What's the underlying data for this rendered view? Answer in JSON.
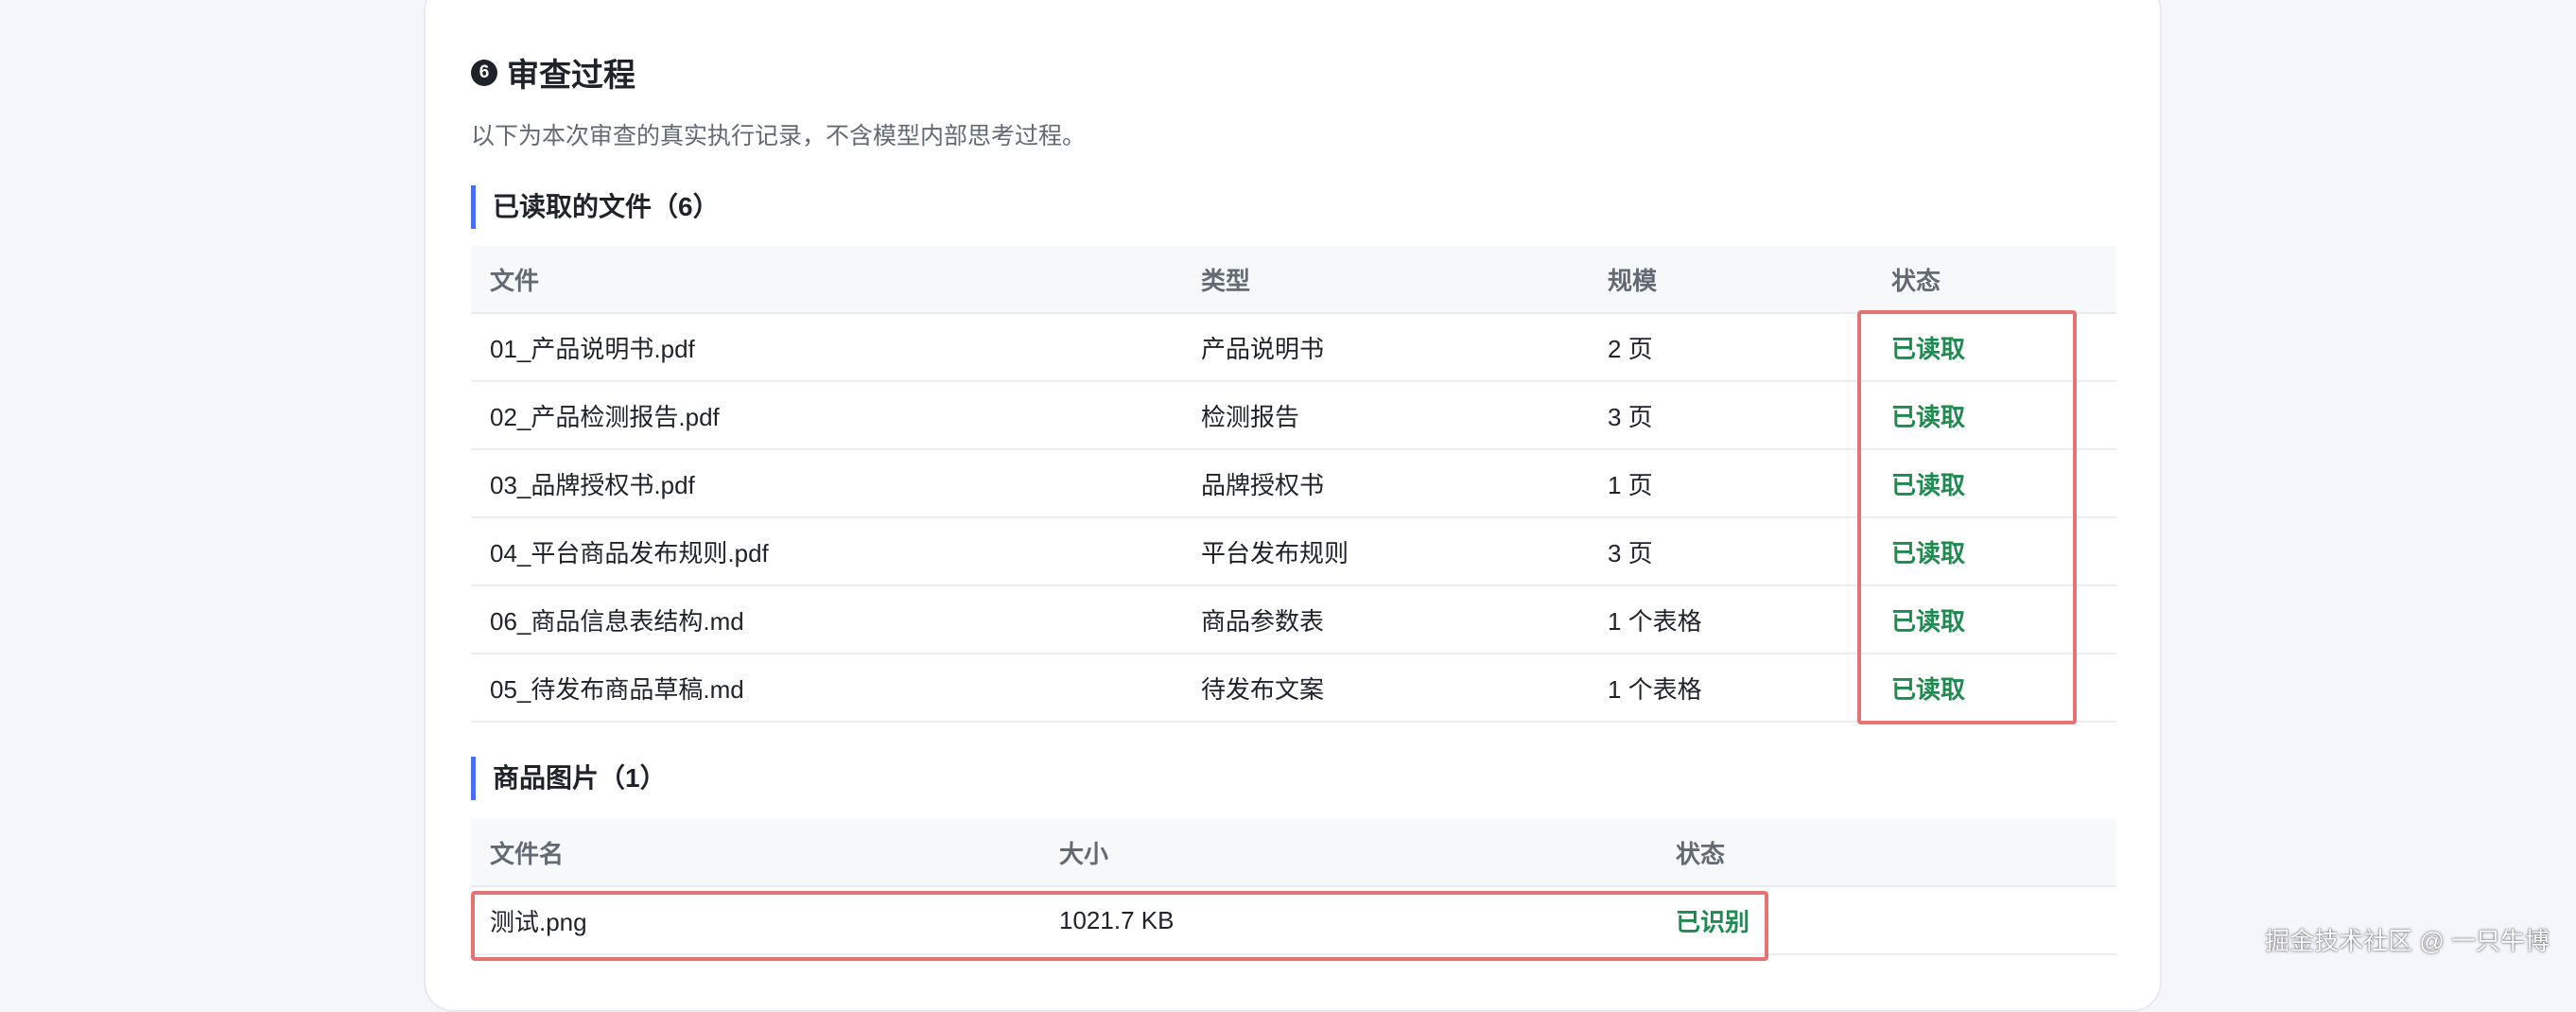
{
  "section": {
    "number": "6",
    "title": "审查过程",
    "subtitle": "以下为本次审查的真实执行记录，不含模型内部思考过程。"
  },
  "files_read": {
    "heading": "已读取的文件（6）",
    "columns": [
      "文件",
      "类型",
      "规模",
      "状态"
    ],
    "rows": [
      {
        "file": "01_产品说明书.pdf",
        "type": "产品说明书",
        "size": "2 页",
        "status": "已读取"
      },
      {
        "file": "02_产品检测报告.pdf",
        "type": "检测报告",
        "size": "3 页",
        "status": "已读取"
      },
      {
        "file": "03_品牌授权书.pdf",
        "type": "品牌授权书",
        "size": "1 页",
        "status": "已读取"
      },
      {
        "file": "04_平台商品发布规则.pdf",
        "type": "平台发布规则",
        "size": "3 页",
        "status": "已读取"
      },
      {
        "file": "06_商品信息表结构.md",
        "type": "商品参数表",
        "size": "1 个表格",
        "status": "已读取"
      },
      {
        "file": "05_待发布商品草稿.md",
        "type": "待发布文案",
        "size": "1 个表格",
        "status": "已读取"
      }
    ]
  },
  "product_images": {
    "heading": "商品图片（1）",
    "columns": [
      "文件名",
      "大小",
      "状态"
    ],
    "rows": [
      {
        "name": "测试.png",
        "size": "1021.7 KB",
        "status": "已识别"
      }
    ]
  },
  "colors": {
    "accent": "#4c6ef5",
    "status_ok": "#1e8a4f",
    "highlight": "#e57373"
  },
  "watermark": "掘金技术社区 @ 一只牛博"
}
